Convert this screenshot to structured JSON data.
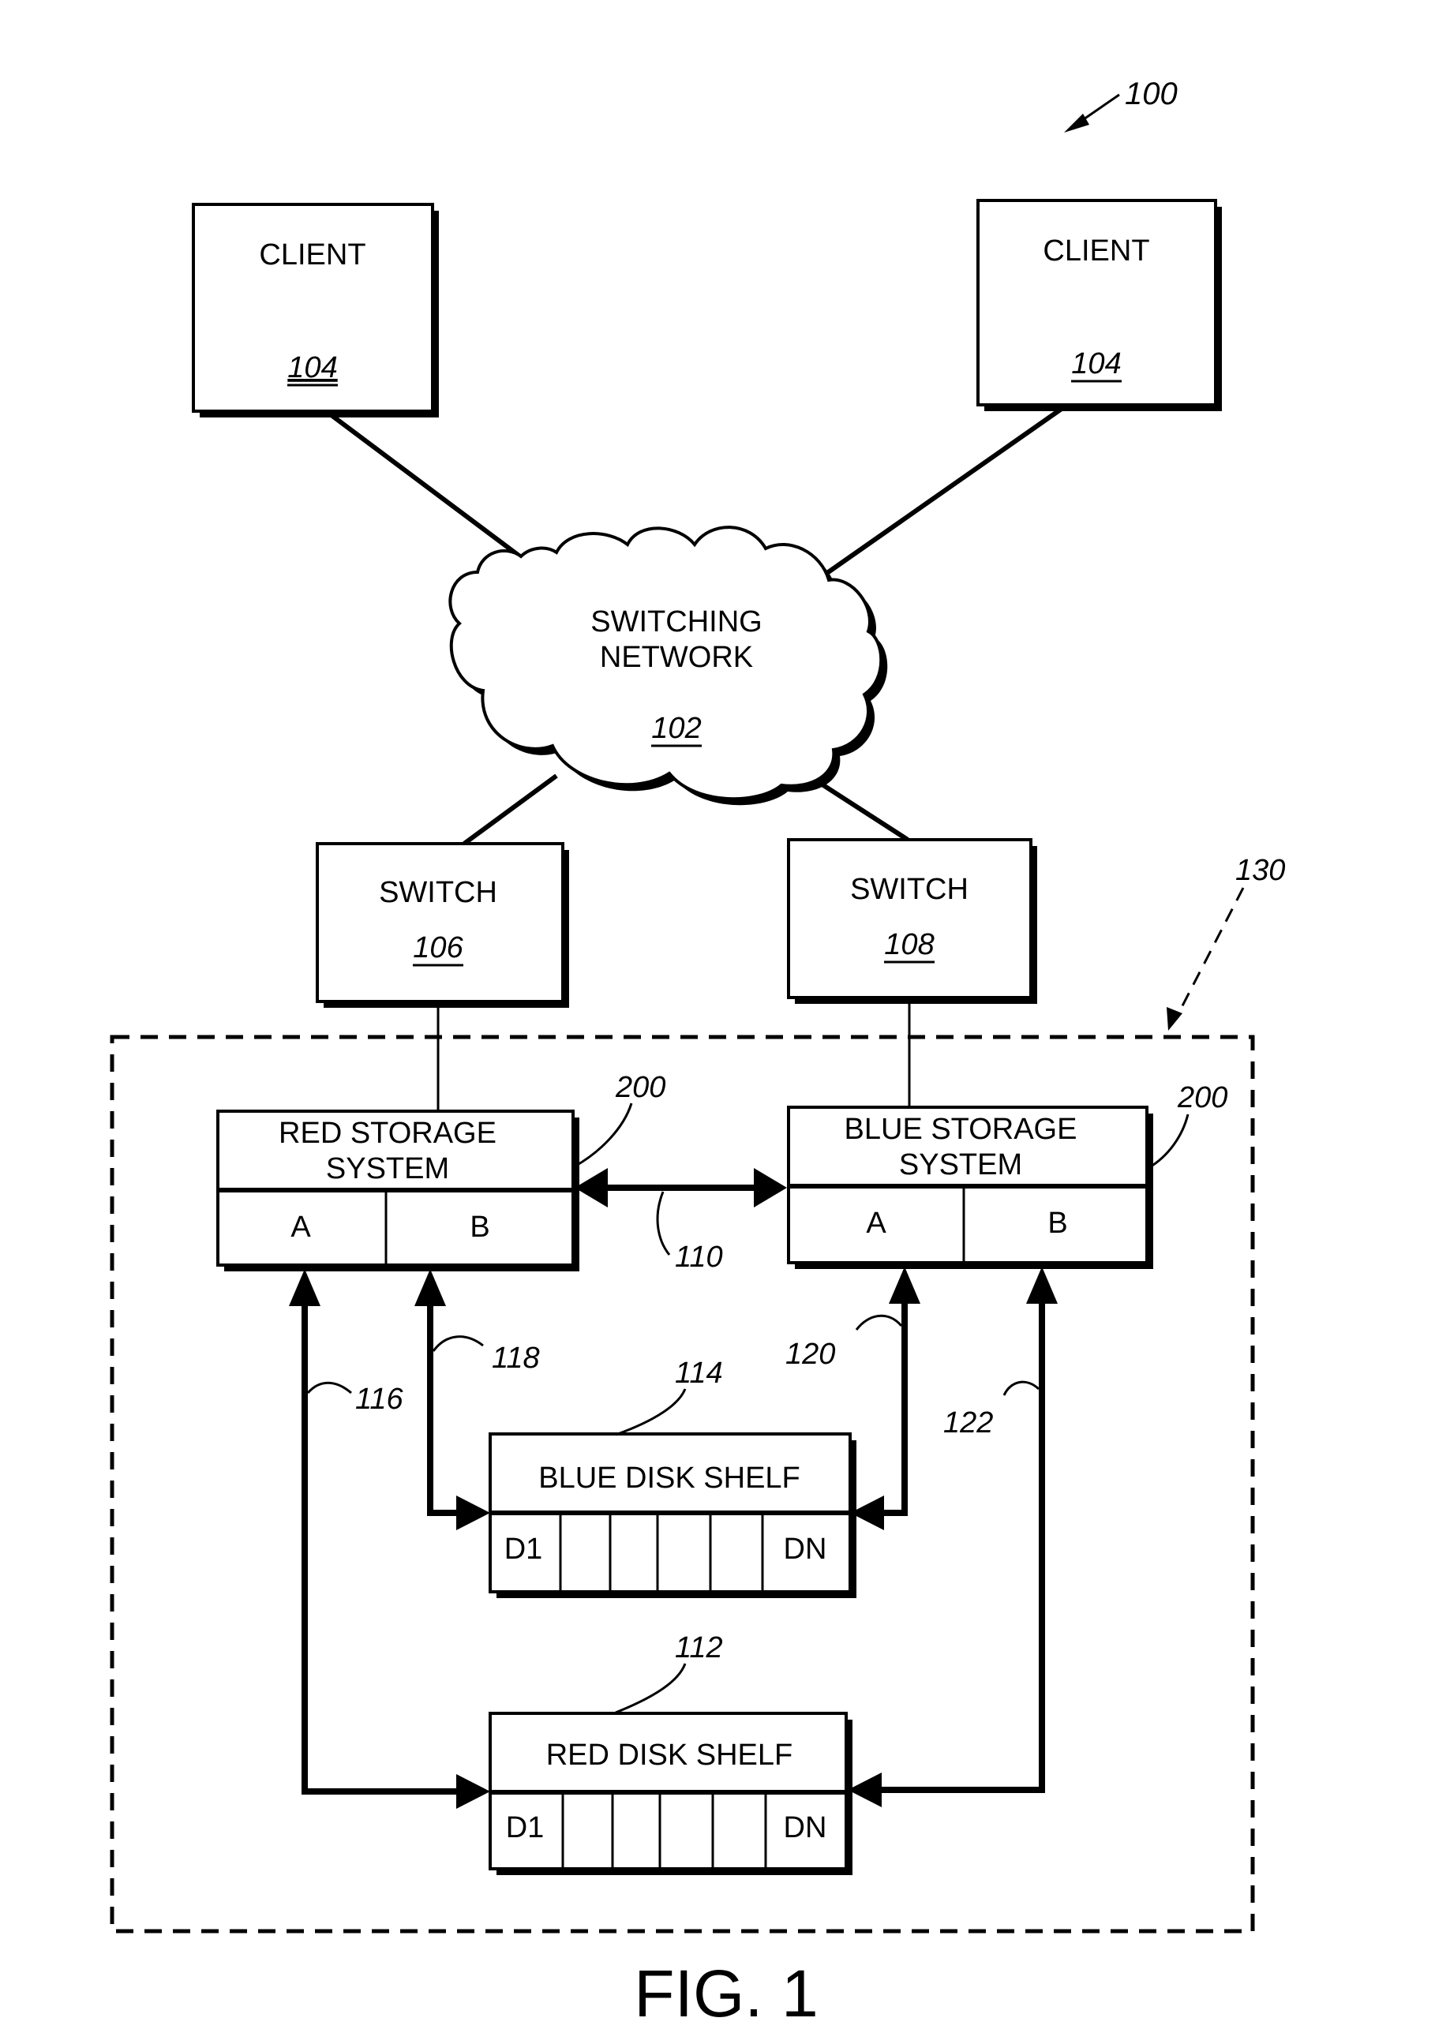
{
  "figure": {
    "title": "FIG. 1",
    "reference": "100"
  },
  "clients": [
    {
      "label": "CLIENT",
      "ref": "104"
    },
    {
      "label": "CLIENT",
      "ref": "104"
    }
  ],
  "network": {
    "label_line1": "SWITCHING",
    "label_line2": "NETWORK",
    "ref": "102"
  },
  "switches": [
    {
      "label": "SWITCH",
      "ref": "106"
    },
    {
      "label": "SWITCH",
      "ref": "108"
    }
  ],
  "cluster": {
    "ref": "130"
  },
  "storage_systems": [
    {
      "label_line1": "RED STORAGE",
      "label_line2": "SYSTEM",
      "ref": "200",
      "port_a": "A",
      "port_b": "B"
    },
    {
      "label_line1": "BLUE STORAGE",
      "label_line2": "SYSTEM",
      "ref": "200",
      "port_a": "A",
      "port_b": "B"
    }
  ],
  "interconnect": {
    "ref": "110"
  },
  "disk_shelves": [
    {
      "label": "BLUE DISK SHELF",
      "ref": "114",
      "first_disk": "D1",
      "last_disk": "DN"
    },
    {
      "label": "RED DISK SHELF",
      "ref": "112",
      "first_disk": "D1",
      "last_disk": "DN"
    }
  ],
  "links": [
    {
      "ref": "116"
    },
    {
      "ref": "118"
    },
    {
      "ref": "120"
    },
    {
      "ref": "122"
    }
  ]
}
